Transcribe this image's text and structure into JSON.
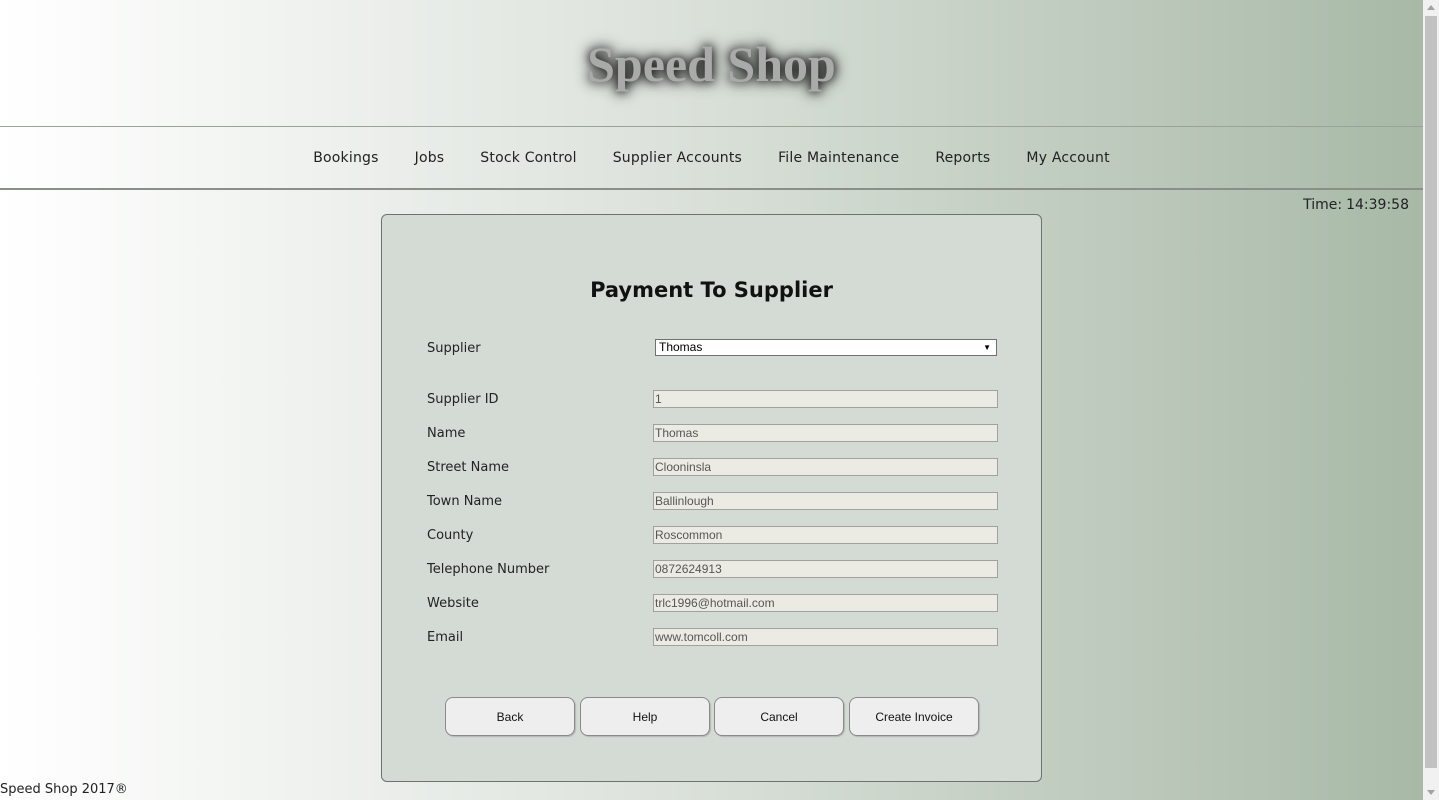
{
  "header": {
    "title": "Speed Shop"
  },
  "nav": {
    "items": [
      {
        "label": "Bookings"
      },
      {
        "label": "Jobs"
      },
      {
        "label": "Stock Control"
      },
      {
        "label": "Supplier Accounts"
      },
      {
        "label": "File Maintenance"
      },
      {
        "label": "Reports"
      },
      {
        "label": "My Account"
      }
    ]
  },
  "clock": {
    "label": "Time:",
    "value": "14:39:58"
  },
  "form": {
    "title": "Payment To Supplier",
    "supplier": {
      "label": "Supplier",
      "selected": "Thomas"
    },
    "fields": [
      {
        "label": "Supplier ID",
        "value": "1"
      },
      {
        "label": "Name",
        "value": "Thomas"
      },
      {
        "label": "Street Name",
        "value": "Clooninsla"
      },
      {
        "label": "Town Name",
        "value": "Ballinlough"
      },
      {
        "label": "County",
        "value": "Roscommon"
      },
      {
        "label": "Telephone Number",
        "value": "0872624913"
      },
      {
        "label": "Website",
        "value": "trlc1996@hotmail.com"
      },
      {
        "label": "Email",
        "value": "www.tomcoll.com"
      }
    ],
    "buttons": {
      "back": "Back",
      "help": "Help",
      "cancel": "Cancel",
      "create_invoice": "Create Invoice"
    }
  },
  "footer": {
    "text": "Speed Shop 2017®"
  }
}
